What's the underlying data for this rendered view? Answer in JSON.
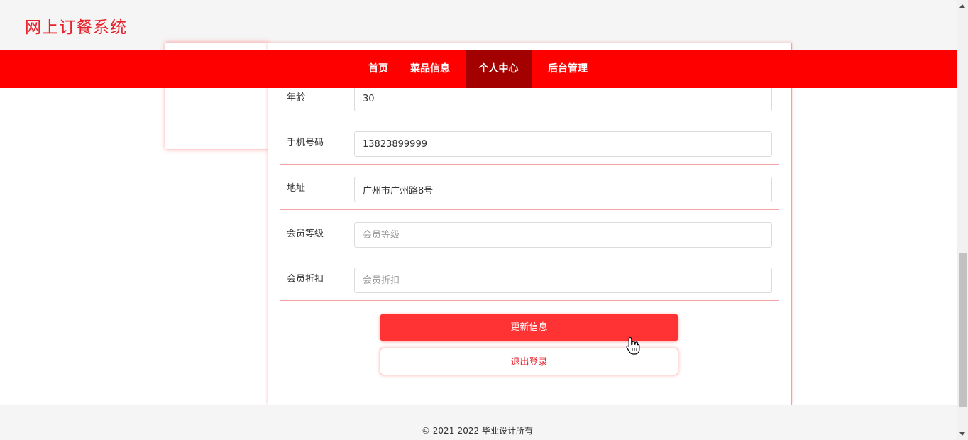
{
  "header": {
    "title": "网上订餐系统"
  },
  "nav": {
    "items": [
      {
        "label": "首页",
        "active": false
      },
      {
        "label": "菜品信息",
        "active": false
      },
      {
        "label": "个人中心",
        "active": true
      },
      {
        "label": "后台管理",
        "active": false
      }
    ]
  },
  "form": {
    "fields": [
      {
        "label": "年龄",
        "value": "30",
        "placeholder": ""
      },
      {
        "label": "手机号码",
        "value": "13823899999",
        "placeholder": ""
      },
      {
        "label": "地址",
        "value": "广州市广州路8号",
        "placeholder": ""
      },
      {
        "label": "会员等级",
        "value": "",
        "placeholder": "会员等级"
      },
      {
        "label": "会员折扣",
        "value": "",
        "placeholder": "会员折扣"
      }
    ],
    "update_label": "更新信息",
    "logout_label": "退出登录"
  },
  "footer": {
    "text": "© 2021-2022 毕业设计所有"
  },
  "colors": {
    "brand": "#ff0000",
    "nav_active": "#a30000",
    "title": "#e8202a",
    "button": "#ff3333"
  },
  "icons": {
    "cursor": "hand-pointer-icon"
  }
}
